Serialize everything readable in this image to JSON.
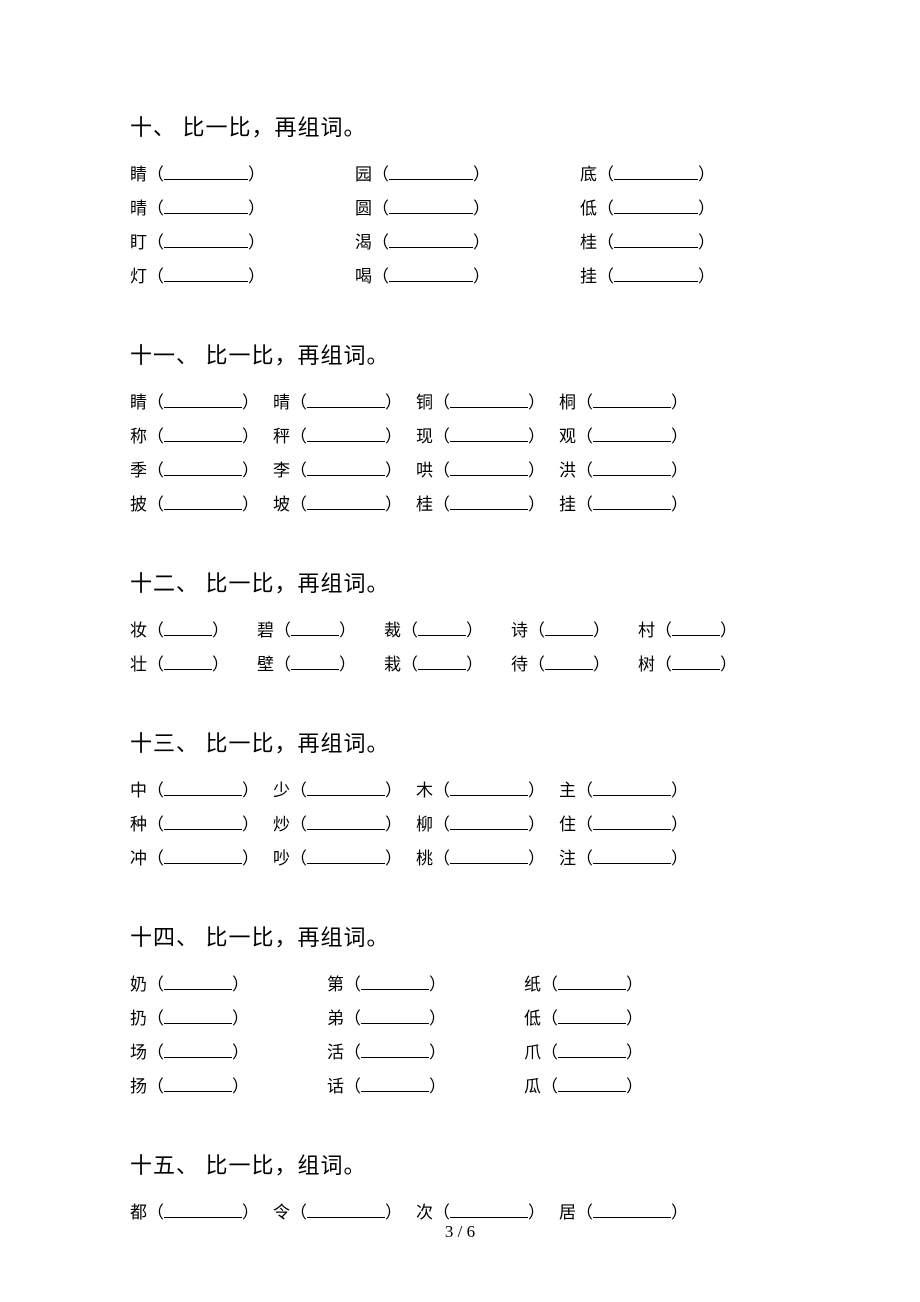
{
  "footer": "3 / 6",
  "sections": [
    {
      "title": "十、 比一比，再组词。",
      "layout": "threecol",
      "blank": 84,
      "gap": 90,
      "rows": [
        [
          "睛",
          "园",
          "底"
        ],
        [
          "晴",
          "圆",
          "低"
        ],
        [
          "盯",
          "渴",
          "桂"
        ],
        [
          "灯",
          "喝",
          "挂"
        ]
      ]
    },
    {
      "title": "十一、 比一比，再组词。",
      "layout": "fourcol",
      "blank": 78,
      "gap": 14,
      "rows": [
        [
          "睛",
          "晴",
          "铜",
          "桐"
        ],
        [
          "称",
          "秤",
          "现",
          "观"
        ],
        [
          "季",
          "李",
          "哄",
          "洪"
        ],
        [
          "披",
          "坡",
          "桂",
          "挂"
        ]
      ]
    },
    {
      "title": "十二、 比一比，再组词。",
      "layout": "fivecol",
      "blank": 48,
      "gap": 28,
      "rows": [
        [
          "妆",
          "碧",
          "裁",
          "诗",
          "村"
        ],
        [
          "壮",
          "壁",
          "栽",
          "待",
          "树"
        ]
      ]
    },
    {
      "title": "十三、 比一比，再组词。",
      "layout": "fourcol",
      "blank": 78,
      "gap": 14,
      "rows": [
        [
          "中",
          "少",
          "木",
          "主"
        ],
        [
          "种",
          "炒",
          "柳",
          "住"
        ],
        [
          "冲",
          "吵",
          "桃",
          "注"
        ]
      ]
    },
    {
      "title": "十四、 比一比，再组词。",
      "layout": "threecol",
      "blank": 68,
      "gap": 78,
      "rows": [
        [
          "奶",
          "第",
          "纸"
        ],
        [
          "扔",
          "弟",
          "低"
        ],
        [
          "场",
          "活",
          "爪"
        ],
        [
          "扬",
          "话",
          "瓜"
        ]
      ]
    },
    {
      "title": "十五、 比一比，组词。",
      "layout": "fourcol",
      "blank": 78,
      "gap": 14,
      "rows": [
        [
          "都",
          "令",
          "次",
          "居"
        ]
      ]
    }
  ]
}
